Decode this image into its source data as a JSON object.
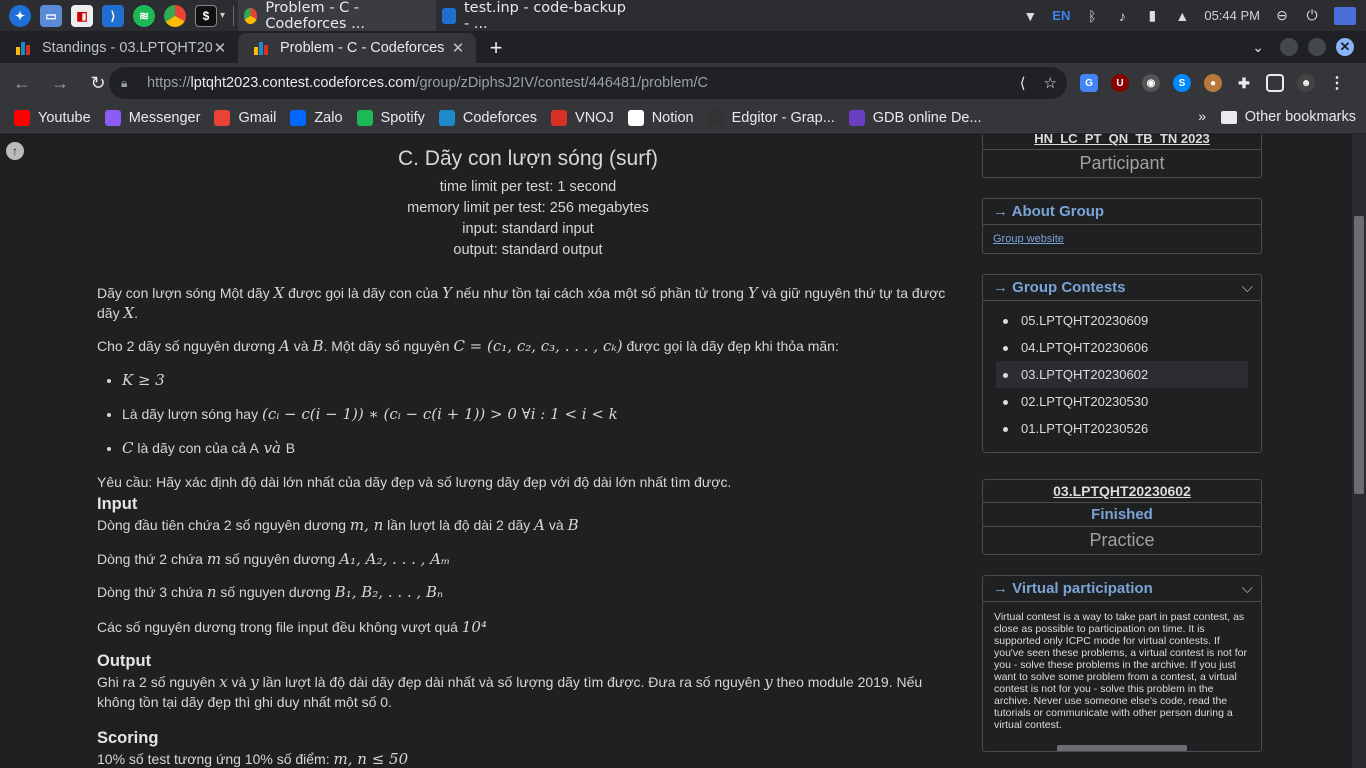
{
  "taskbar": {
    "tasks": [
      {
        "label": "Problem - C - Codeforces ..."
      },
      {
        "label": "test.inp - code-backup - ..."
      }
    ],
    "tray": {
      "lang": "EN",
      "clock": "05:44 PM"
    }
  },
  "tabs": [
    {
      "title": "Standings - 03.LPTQHT20",
      "close": "✕"
    },
    {
      "title": "Problem - C - Codeforces",
      "close": "✕"
    }
  ],
  "newtab": "+",
  "address": {
    "scheme": "https://",
    "host": "lptqht2023.contest.codeforces.com",
    "path": "/group/zDiphsJ2IV/contest/446481/problem/C"
  },
  "bookmarks": [
    {
      "label": "Youtube",
      "icon": "youtube-icon",
      "color": "#ff0000"
    },
    {
      "label": "Messenger",
      "icon": "messenger-icon",
      "color": "#8b5cf6"
    },
    {
      "label": "Gmail",
      "icon": "gmail-icon",
      "color": "#ea4335"
    },
    {
      "label": "Zalo",
      "icon": "zalo-icon",
      "color": "#0068ff"
    },
    {
      "label": "Spotify",
      "icon": "spotify-icon",
      "color": "#1db954"
    },
    {
      "label": "Codeforces",
      "icon": "codeforces-icon",
      "color": "#1f8acb"
    },
    {
      "label": "VNOJ",
      "icon": "vnoj-icon",
      "color": "#d93025"
    },
    {
      "label": "Notion",
      "icon": "notion-icon",
      "color": "#ffffff"
    },
    {
      "label": "Edgitor - Grap...",
      "icon": "edgitor-icon",
      "color": "#333333"
    },
    {
      "label": "GDB online De...",
      "icon": "gdb-icon",
      "color": "#6c3ec1"
    }
  ],
  "bookmarks_more": "»",
  "bookmarks_other": "Other bookmarks",
  "problem": {
    "title": "C. Dãy con lượn sóng (surf)",
    "time_limit": "time limit per test: 1 second",
    "memory_limit": "memory limit per test: 256 megabytes",
    "input": "input: standard input",
    "output": "output: standard output",
    "p1": [
      "Dãy con lượn sóng Một dãy ",
      "X",
      " được gọi là dãy con của ",
      "Y",
      " nếu như tồn tại cách xóa một số phần tử trong ",
      "Y",
      " và giữ nguyên thứ tự ta được dãy ",
      "X",
      "."
    ],
    "p2": [
      "Cho 2 dãy số nguyên dương ",
      "A",
      " và ",
      "B",
      ". Một dãy số nguyên ",
      "C = (c₁, c₂, c₃, . . . , cₖ)",
      " được gọi là dãy đẹp khi thỏa mãn:"
    ],
    "bullets": [
      [
        "",
        "K ≥ 3",
        ""
      ],
      [
        "Là dãy lượn sóng hay ",
        "(cᵢ − c(i − 1)) ∗ (cᵢ − c(i + 1)) > 0 ∀i : 1 < i < k",
        ""
      ],
      [
        "",
        "C",
        " là dãy con của cả "
      ]
    ],
    "bullet3_ab": [
      "A",
      " và ",
      "B"
    ],
    "req": "Yêu cầu: Hãy xác định độ dài lớn nhất của dãy đẹp và số lượng dãy đẹp với độ dài lớn nhất tìm được.",
    "input_title": "Input",
    "in1": [
      "Dòng đầu tiên chứa 2 số nguyên dương ",
      "m, n",
      " lần lượt là độ dài 2 dãy ",
      "A",
      " và ",
      "B"
    ],
    "in2": [
      "Dòng thứ 2 chứa ",
      "m",
      " số nguyên dương ",
      "A₁, A₂, . . . , Aₘ"
    ],
    "in3": [
      "Dòng thứ 3 chứa ",
      "n",
      " số nguyen dương ",
      "B₁, B₂, . . . , Bₙ"
    ],
    "in4": [
      "Các số nguyên dương trong file input đều không vượt quá ",
      "10⁴"
    ],
    "output_title": "Output",
    "out1": [
      "Ghi ra 2 số nguyên ",
      "x",
      " và ",
      "y",
      " lần lượt là độ dài dãy đẹp dài nhất và số lượng dãy tìm được. Đưa ra số nguyên ",
      "y",
      " theo module 2019. Nếu không tồn tại dãy đẹp thì ghi duy nhất một số 0."
    ],
    "scoring_title": "Scoring",
    "sc1": [
      "10% số test tương ứng 10% số điểm: ",
      "m, n ≤ 50"
    ]
  },
  "sidebar": {
    "group_name": "HN_LC_PT_QN_TB_TN 2023",
    "participant": "Participant",
    "about": {
      "title": "→ About Group",
      "link": "Group website"
    },
    "contests": {
      "title": "→ Group Contests",
      "items": [
        "05.LPTQHT20230609",
        "04.LPTQHT20230606",
        "03.LPTQHT20230602",
        "02.LPTQHT20230530",
        "01.LPTQHT20230526"
      ],
      "current": 2
    },
    "contest_box": {
      "name": "03.LPTQHT20230602",
      "status": "Finished",
      "mode": "Practice"
    },
    "virtual": {
      "title": "→ Virtual participation",
      "text": "Virtual contest is a way to take part in past contest, as close as possible to participation on time. It is supported only ICPC mode for virtual contests. If you've seen these problems, a virtual contest is not for you - solve these problems in the archive. If you just want to solve some problem from a contest, a virtual contest is not for you - solve this problem in the archive. Never use someone else's code, read the tutorials or communicate with other person during a virtual contest."
    }
  }
}
